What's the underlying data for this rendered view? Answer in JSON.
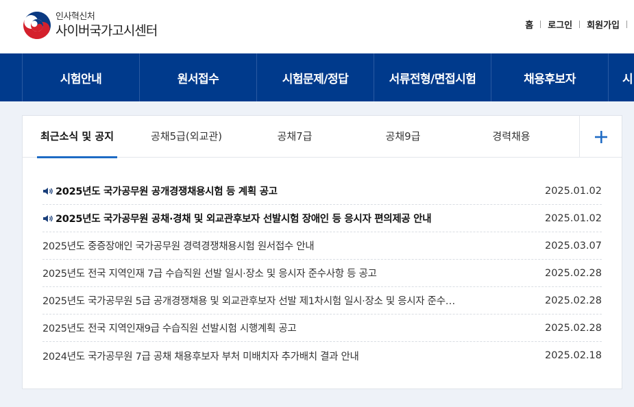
{
  "header": {
    "org_name": "인사혁신처",
    "site_name": "사이버국가고시센터",
    "util_links": [
      "홈",
      "로그인",
      "회원가입"
    ]
  },
  "gnb": {
    "items": [
      "시험안내",
      "원서접수",
      "시험문제/정답",
      "서류전형/면접시험",
      "채용후보자",
      "시"
    ]
  },
  "tabs": {
    "items": [
      "최근소식 및 공지",
      "공채5급(외교관)",
      "공채7급",
      "공채9급",
      "경력채용"
    ],
    "active_index": 0,
    "more_icon": "plus-icon"
  },
  "notices": [
    {
      "title": "2025년도 국가공무원 공개경쟁채용시험 등 계획 공고",
      "date": "2025.01.02",
      "pinned": true
    },
    {
      "title": "2025년도 국가공무원 공채·경채 및 외교관후보자 선발시험 장애인 등 응시자 편의제공 안내",
      "date": "2025.01.02",
      "pinned": true
    },
    {
      "title": "2025년도 중증장애인 국가공무원 경력경쟁채용시험 원서접수 안내",
      "date": "2025.03.07",
      "pinned": false
    },
    {
      "title": "2025년도 전국 지역인재 7급 수습직원 선발 일시·장소 및 응시자 준수사항 등 공고",
      "date": "2025.02.28",
      "pinned": false
    },
    {
      "title": "2025년도 국가공무원 5급 공개경쟁채용 및 외교관후보자 선발 제1차시험 일시·장소 및 응시자 준수…",
      "date": "2025.02.28",
      "pinned": false
    },
    {
      "title": "2025년도 전국 지역인재9급 수습직원 선발시험 시행계획 공고",
      "date": "2025.02.28",
      "pinned": false
    },
    {
      "title": "2024년도 국가공무원 7급 공채 채용후보자 부처 미배치자 추가배치 결과 안내",
      "date": "2025.02.18",
      "pinned": false
    }
  ],
  "colors": {
    "gnb_bg": "#003a8c",
    "tab_active_bar": "#1e6bc4",
    "plus_icon": "#1e6bc4"
  }
}
